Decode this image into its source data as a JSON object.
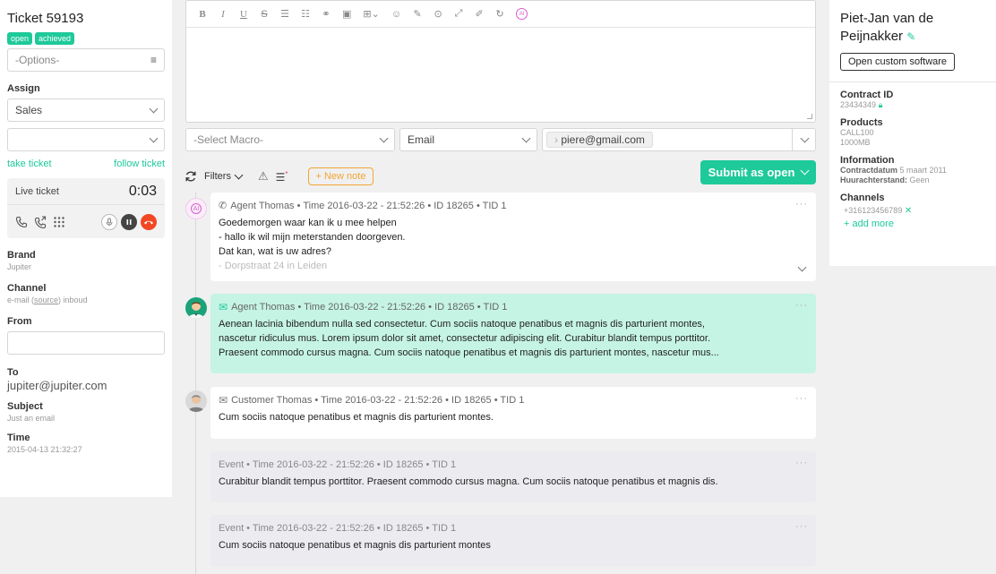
{
  "ticket": {
    "title": "Ticket 59193",
    "badges": [
      "open",
      "achieved"
    ],
    "options_placeholder": "-Options-",
    "assign_label": "Assign",
    "assign_value": "Sales",
    "take_ticket": "take ticket",
    "follow_ticket": "follow ticket",
    "live_ticket_label": "Live ticket",
    "live_timer": "0:03",
    "brand_label": "Brand",
    "brand_value": "Jupiter",
    "channel_label": "Channel",
    "channel_value_pre": "e-mail (",
    "channel_value_link": "source",
    "channel_value_post": ") inboud",
    "from_label": "From",
    "to_label": "To",
    "to_value": "jupiter@jupiter.com",
    "subject_label": "Subject",
    "subject_value": "Just an email",
    "time_label": "Time",
    "time_value": "2015-04-13 21:32:27"
  },
  "composer": {
    "macro_placeholder": "-Select Macro-",
    "channel_value": "Email",
    "recipient": "piere@gmail.com"
  },
  "actions": {
    "filters_label": "Filters",
    "new_note_label": "+ New note",
    "submit_label": "Submit as open"
  },
  "timeline": [
    {
      "meta": "Agent Thomas • Time 2016-03-22 - 21:52:26 • ID 18265 • TID 1",
      "lines": [
        "Goedemorgen waar kan ik u mee helpen",
        "- hallo ik wil mijn meterstanden doorgeven.",
        "Dat kan, wat is uw adres?",
        "- Dorpstraat 24 in Leiden"
      ]
    },
    {
      "meta": "Agent Thomas • Time 2016-03-22 - 21:52:26 • ID 18265 • TID 1",
      "lines": [
        "Aenean lacinia bibendum nulla sed consectetur. Cum sociis natoque penatibus et magnis dis parturient montes,",
        "nascetur ridiculus mus. Lorem ipsum dolor sit amet, consectetur adipiscing elit. Curabitur blandit tempus porttitor.",
        "Praesent commodo cursus magna. Cum sociis natoque penatibus et magnis dis parturient montes, nascetur mus..."
      ]
    },
    {
      "meta": "Customer Thomas • Time 2016-03-22 - 21:52:26 • ID 18265 • TID 1",
      "lines": [
        "Cum sociis natoque penatibus et magnis dis parturient montes."
      ]
    },
    {
      "meta": "Event • Time 2016-03-22 - 21:52:26 • ID 18265 • TID 1",
      "lines": [
        "Curabitur blandit tempus porttitor. Praesent commodo cursus magna. Cum sociis natoque penatibus et magnis dis."
      ]
    },
    {
      "meta": "Event • Time 2016-03-22 - 21:52:26 • ID 18265 • TID 1",
      "lines": [
        "Cum sociis natoque penatibus et magnis dis parturient montes"
      ]
    }
  ],
  "contact": {
    "name": "Piet-Jan van de Peijnakker",
    "open_button": "Open custom software",
    "contract_label": "Contract ID",
    "contract_value": "23434349",
    "products_label": "Products",
    "products": [
      "CALL100",
      "1000MB"
    ],
    "information_label": "Information",
    "info_1_key": "Contractdatum",
    "info_1_val": "5 maart 2011",
    "info_2_key": "Huurachterstand:",
    "info_2_val": "Geen",
    "channels_label": "Channels",
    "phone": "+316123456789",
    "add_more": "+ add more"
  },
  "colors": {
    "accent": "#1ec99a",
    "note_orange": "#f2a534",
    "hangup_red": "#f24822",
    "agent_bubble": "#c6f4e4",
    "event_bubble": "#ececf0"
  }
}
